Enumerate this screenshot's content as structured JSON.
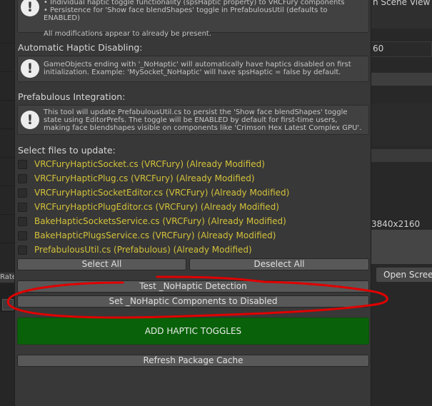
{
  "background": {
    "right_items": [
      {
        "label": "n Scene View"
      },
      {
        "label": "60"
      },
      {
        "label": "3840x2160"
      }
    ],
    "open_button": "Open Screen",
    "left_label": "Rate"
  },
  "notice_box": {
    "lines": [
      "• Individual haptic toggle functionality (spsHaptic property) to VRCFury components",
      "• Persistence for 'Show face blendShapes' toggle in PrefabulousUtil (defaults to ENABLED)",
      "",
      "All modifications appear to already be present."
    ]
  },
  "auto_haptic": {
    "title": "Automatic Haptic Disabling:",
    "text": "GameObjects ending with '_NoHaptic' will automatically have haptics disabled on first initialization. Example: 'MySocket_NoHaptic' will have spsHaptic = false by default."
  },
  "prefabulous": {
    "title": "Prefabulous Integration:",
    "text": "This tool will update PrefabulousUtil.cs to persist the 'Show face blendShapes' toggle state using EditorPrefs. The toggle will be ENABLED by default for first-time users, making face blendshapes visible on components like 'Crimson Hex Latest Complex GPU'."
  },
  "files": {
    "title": "Select files to update:",
    "items": [
      {
        "label": "VRCFuryHapticSocket.cs (VRCFury) (Already Modified)"
      },
      {
        "label": "VRCFuryHapticPlug.cs (VRCFury) (Already Modified)"
      },
      {
        "label": "VRCFuryHapticSocketEditor.cs (VRCFury) (Already Modified)"
      },
      {
        "label": "VRCFuryHapticPlugEditor.cs (VRCFury) (Already Modified)"
      },
      {
        "label": "BakeHapticSocketsService.cs (VRCFury) (Already Modified)"
      },
      {
        "label": "BakeHapticPlugsService.cs (VRCFury) (Already Modified)"
      },
      {
        "label": "PrefabulousUtil.cs (Prefabulous) (Already Modified)"
      }
    ],
    "label_color": "#d4c23a"
  },
  "buttons": {
    "select_all": "Select All",
    "deselect_all": "Deselect All",
    "test_nohaptic": "Test _NoHaptic Detection",
    "set_nohaptic": "Set _NoHaptic Components to Disabled",
    "add_haptic": "ADD HAPTIC TOGGLES",
    "refresh": "Refresh Package Cache"
  },
  "colors": {
    "panel_bg": "#383838",
    "button_bg": "#585858",
    "green_button": "#096209",
    "annotation_red": "#e00000"
  },
  "icons": {
    "help_icon": "exclamation-circle-icon"
  }
}
